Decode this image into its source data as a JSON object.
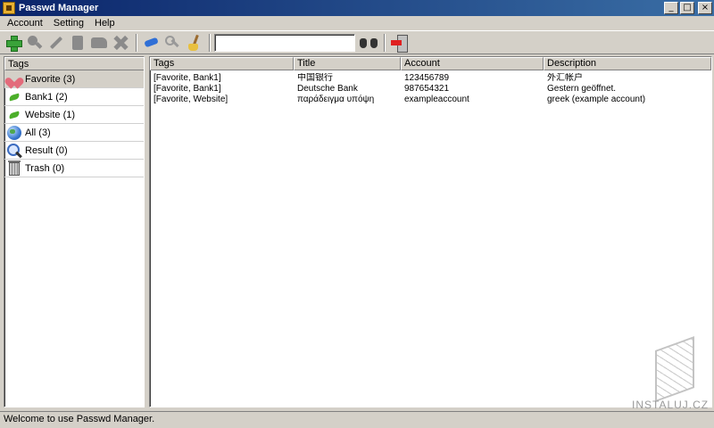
{
  "window": {
    "title": "Passwd Manager",
    "buttons": {
      "minimize": "_",
      "maximize": "□",
      "close": "×"
    }
  },
  "menu": {
    "items": [
      "Account",
      "Setting",
      "Help"
    ]
  },
  "toolbar": {
    "icons": [
      "add-icon",
      "find-icon",
      "edit-icon",
      "copy-icon",
      "paste-icon",
      "delete-icon",
      "eraser-icon",
      "key-icon",
      "broom-icon",
      "binoculars-icon",
      "exit-icon"
    ],
    "search_value": ""
  },
  "tags_panel": {
    "header": "Tags",
    "items": [
      {
        "label": "Favorite (3)",
        "icon": "heart-icon",
        "selected": true
      },
      {
        "label": "Bank1 (2)",
        "icon": "leaf-icon",
        "selected": false
      },
      {
        "label": "Website (1)",
        "icon": "leaf-icon",
        "selected": false
      },
      {
        "label": "All (3)",
        "icon": "globe-icon",
        "selected": false
      },
      {
        "label": "Result (0)",
        "icon": "search-icon",
        "selected": false
      },
      {
        "label": "Trash (0)",
        "icon": "trash-icon",
        "selected": false
      }
    ]
  },
  "accounts_table": {
    "columns": [
      "Tags",
      "Title",
      "Account",
      "Description"
    ],
    "rows": [
      [
        "[Favorite, Bank1]",
        "中国银行",
        "123456789",
        "外汇帐户"
      ],
      [
        "[Favorite, Bank1]",
        "Deutsche Bank",
        "987654321",
        "Gestern geöffnet."
      ],
      [
        "[Favorite, Website]",
        "παράδειγμα υπόψη",
        "exampleaccount",
        "greek (example account)"
      ]
    ]
  },
  "status": {
    "text": "Welcome to use Passwd Manager."
  },
  "watermark": {
    "text": "INSTALUJ.CZ"
  }
}
